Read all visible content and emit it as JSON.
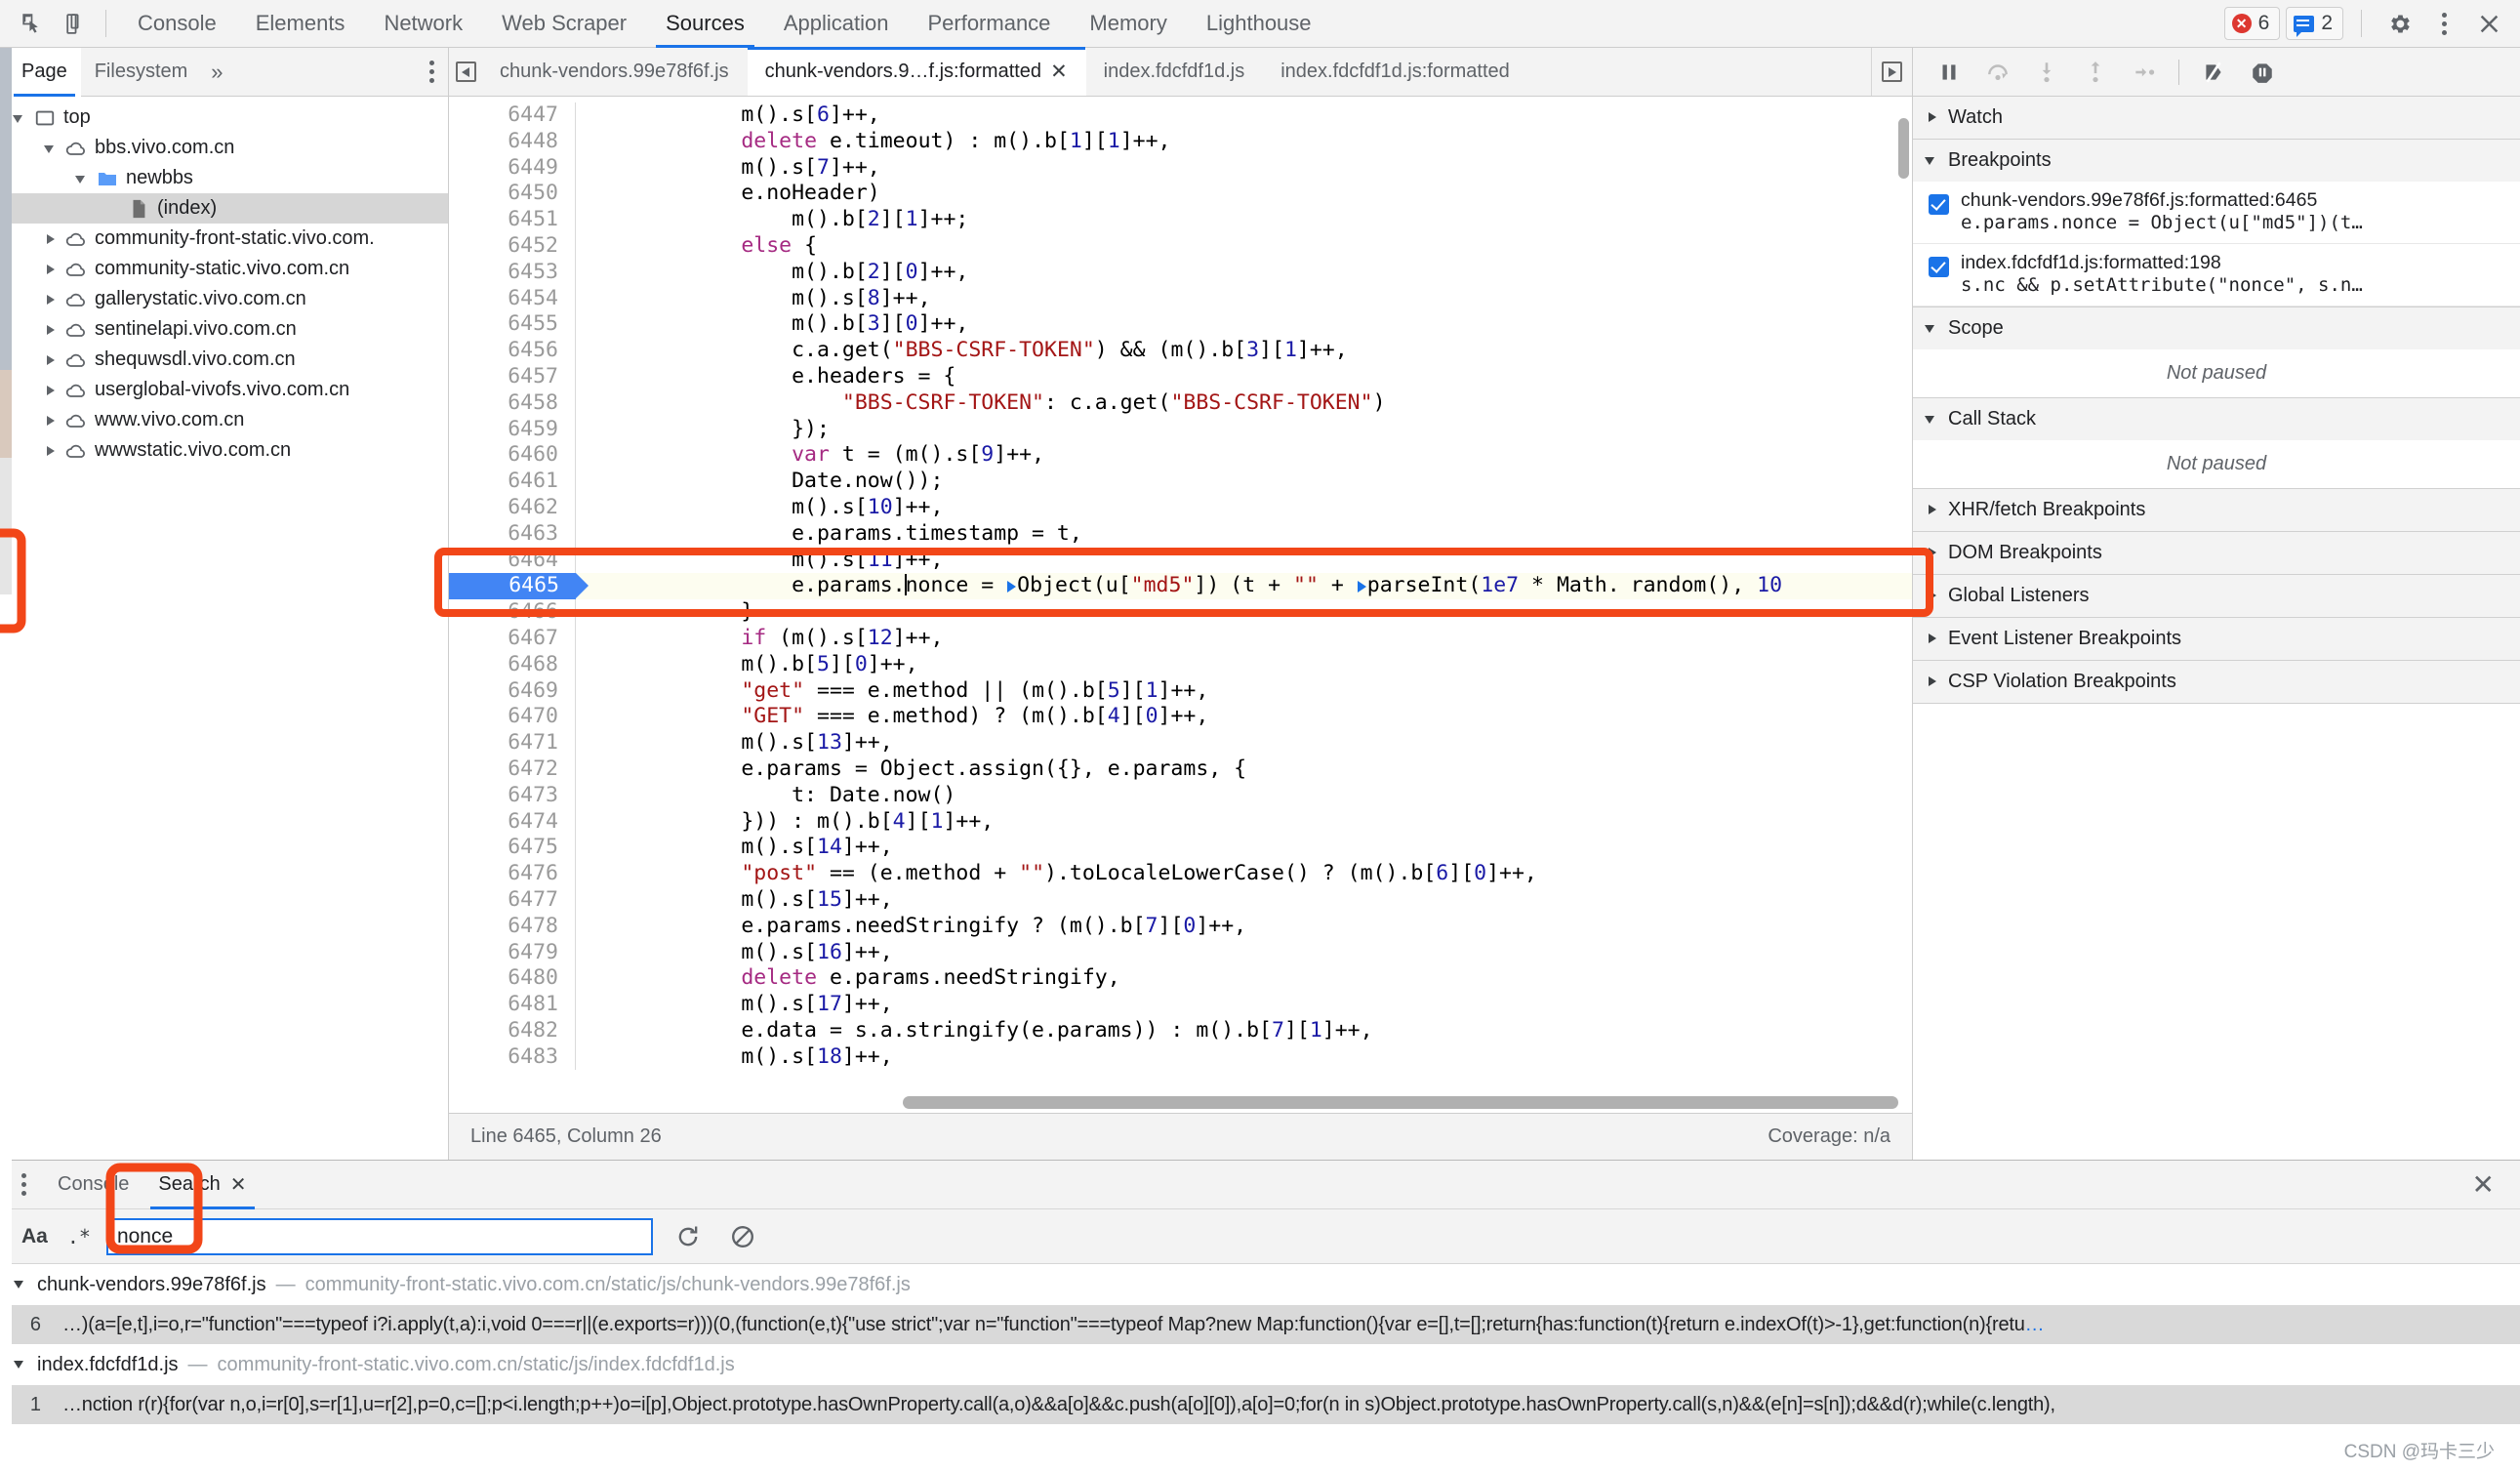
{
  "toolbar": {
    "icons": [
      "inspect-icon",
      "device-toggle-icon"
    ],
    "tabs": [
      {
        "label": "Console",
        "active": false
      },
      {
        "label": "Elements",
        "active": false
      },
      {
        "label": "Network",
        "active": false
      },
      {
        "label": "Web Scraper",
        "active": false
      },
      {
        "label": "Sources",
        "active": true
      },
      {
        "label": "Application",
        "active": false
      },
      {
        "label": "Performance",
        "active": false
      },
      {
        "label": "Memory",
        "active": false
      },
      {
        "label": "Lighthouse",
        "active": false
      }
    ],
    "error_count": "6",
    "message_count": "2",
    "settings_icon": "gear-icon",
    "more_icon": "kebab-menu-icon",
    "close_icon": "close-icon"
  },
  "navigator": {
    "tabs": [
      {
        "label": "Page",
        "active": true
      },
      {
        "label": "Filesystem",
        "active": false
      }
    ],
    "more_label": "»",
    "tree": [
      {
        "label": "top",
        "depth": 0,
        "icon": "frame-icon",
        "expanded": true,
        "selected": false
      },
      {
        "label": "bbs.vivo.com.cn",
        "depth": 1,
        "icon": "cloud-icon",
        "expanded": true,
        "selected": false
      },
      {
        "label": "newbbs",
        "depth": 2,
        "icon": "folder-icon",
        "expanded": true,
        "selected": false
      },
      {
        "label": "(index)",
        "depth": 3,
        "icon": "document-icon",
        "expanded": null,
        "selected": true
      },
      {
        "label": "community-front-static.vivo.com.",
        "depth": 1,
        "icon": "cloud-icon",
        "expanded": false,
        "selected": false
      },
      {
        "label": "community-static.vivo.com.cn",
        "depth": 1,
        "icon": "cloud-icon",
        "expanded": false,
        "selected": false
      },
      {
        "label": "gallerystatic.vivo.com.cn",
        "depth": 1,
        "icon": "cloud-icon",
        "expanded": false,
        "selected": false
      },
      {
        "label": "sentinelapi.vivo.com.cn",
        "depth": 1,
        "icon": "cloud-icon",
        "expanded": false,
        "selected": false
      },
      {
        "label": "shequwsdl.vivo.com.cn",
        "depth": 1,
        "icon": "cloud-icon",
        "expanded": false,
        "selected": false
      },
      {
        "label": "userglobal-vivofs.vivo.com.cn",
        "depth": 1,
        "icon": "cloud-icon",
        "expanded": false,
        "selected": false
      },
      {
        "label": "www.vivo.com.cn",
        "depth": 1,
        "icon": "cloud-icon",
        "expanded": false,
        "selected": false
      },
      {
        "label": "wwwstatic.vivo.com.cn",
        "depth": 1,
        "icon": "cloud-icon",
        "expanded": false,
        "selected": false
      }
    ]
  },
  "editor": {
    "file_tabs": [
      {
        "label": "chunk-vendors.99e78f6f.js",
        "active": false,
        "closable": false
      },
      {
        "label": "chunk-vendors.9…f.js:formatted",
        "active": true,
        "closable": true
      },
      {
        "label": "index.fdcfdf1d.js",
        "active": false,
        "closable": false
      },
      {
        "label": "index.fdcfdf1d.js:formatted",
        "active": false,
        "closable": false
      }
    ],
    "status_left": "Line 6465, Column 26",
    "status_right": "Coverage: n/a",
    "lines": [
      {
        "n": "6447",
        "code": "            m().s[6]++,"
      },
      {
        "n": "6448",
        "code": "            delete e.timeout) : m().b[1][1]++,"
      },
      {
        "n": "6449",
        "code": "            m().s[7]++,"
      },
      {
        "n": "6450",
        "code": "            e.noHeader)"
      },
      {
        "n": "6451",
        "code": "                m().b[2][1]++;"
      },
      {
        "n": "6452",
        "code": "            else {"
      },
      {
        "n": "6453",
        "code": "                m().b[2][0]++,"
      },
      {
        "n": "6454",
        "code": "                m().s[8]++,"
      },
      {
        "n": "6455",
        "code": "                m().b[3][0]++,"
      },
      {
        "n": "6456",
        "code": "                c.a.get(\"BBS-CSRF-TOKEN\") && (m().b[3][1]++,"
      },
      {
        "n": "6457",
        "code": "                e.headers = {"
      },
      {
        "n": "6458",
        "code": "                    \"BBS-CSRF-TOKEN\": c.a.get(\"BBS-CSRF-TOKEN\")"
      },
      {
        "n": "6459",
        "code": "                });"
      },
      {
        "n": "6460",
        "code": "                var t = (m().s[9]++,"
      },
      {
        "n": "6461",
        "code": "                Date.now());"
      },
      {
        "n": "6462",
        "code": "                m().s[10]++,"
      },
      {
        "n": "6463",
        "code": "                e.params.timestamp = t,"
      },
      {
        "n": "6464",
        "code": "                m().s[11]++,"
      },
      {
        "n": "6465",
        "code": "                e.params.nonce = Object(u[\"md5\"])(t + \"\" + parseInt(1e7 * Math.random(), 10"
      },
      {
        "n": "6466",
        "code": "            }"
      },
      {
        "n": "6467",
        "code": "            if (m().s[12]++,"
      },
      {
        "n": "6468",
        "code": "            m().b[5][0]++,"
      },
      {
        "n": "6469",
        "code": "            \"get\" === e.method || (m().b[5][1]++,"
      },
      {
        "n": "6470",
        "code": "            \"GET\" === e.method) ? (m().b[4][0]++,"
      },
      {
        "n": "6471",
        "code": "            m().s[13]++,"
      },
      {
        "n": "6472",
        "code": "            e.params = Object.assign({}, e.params, {"
      },
      {
        "n": "6473",
        "code": "                t: Date.now()"
      },
      {
        "n": "6474",
        "code": "            })) : m().b[4][1]++,"
      },
      {
        "n": "6475",
        "code": "            m().s[14]++,"
      },
      {
        "n": "6476",
        "code": "            \"post\" == (e.method + \"\").toLocaleLowerCase() ? (m().b[6][0]++,"
      },
      {
        "n": "6477",
        "code": "            m().s[15]++,"
      },
      {
        "n": "6478",
        "code": "            e.params.needStringify ? (m().b[7][0]++,"
      },
      {
        "n": "6479",
        "code": "            m().s[16]++,"
      },
      {
        "n": "6480",
        "code": "            delete e.params.needStringify,"
      },
      {
        "n": "6481",
        "code": "            m().s[17]++,"
      },
      {
        "n": "6482",
        "code": "            e.data = s.a.stringify(e.params)) : m().b[7][1]++,"
      },
      {
        "n": "6483",
        "code": "            m().s[18]++,"
      }
    ],
    "breakpoint_line": "6465"
  },
  "debugger": {
    "controls": [
      "resume-icon",
      "step-over-icon",
      "step-into-icon",
      "step-out-icon",
      "step-icon",
      "deactivate-breakpoints-icon",
      "pause-on-exceptions-icon"
    ],
    "sections": [
      {
        "title": "Watch",
        "expanded": false
      },
      {
        "title": "Breakpoints",
        "expanded": true
      },
      {
        "title": "Scope",
        "expanded": true
      },
      {
        "title": "Call Stack",
        "expanded": true
      },
      {
        "title": "XHR/fetch Breakpoints",
        "expanded": false
      },
      {
        "title": "DOM Breakpoints",
        "expanded": false
      },
      {
        "title": "Global Listeners",
        "expanded": false
      },
      {
        "title": "Event Listener Breakpoints",
        "expanded": false
      },
      {
        "title": "CSP Violation Breakpoints",
        "expanded": false
      }
    ],
    "breakpoints": [
      {
        "checked": true,
        "location": "chunk-vendors.99e78f6f.js:formatted:6465",
        "snippet": "e.params.nonce = Object(u[\"md5\"])(t…"
      },
      {
        "checked": true,
        "location": "index.fdcfdf1d.js:formatted:198",
        "snippet": "s.nc && p.setAttribute(\"nonce\", s.n…"
      }
    ],
    "scope_status": "Not paused",
    "callstack_status": "Not paused"
  },
  "drawer": {
    "menu_icon": "kebab-menu-icon",
    "tabs": [
      {
        "label": "Console",
        "active": false,
        "closable": false
      },
      {
        "label": "Search",
        "active": true,
        "closable": true
      }
    ],
    "close_icon": "close-icon",
    "search": {
      "match_case_label": "Aa",
      "regex_label": ".*",
      "value": "nonce",
      "refresh_icon": "refresh-icon",
      "clear_icon": "clear-icon"
    },
    "results": [
      {
        "file": "chunk-vendors.99e78f6f.js",
        "dash": "—",
        "url": "community-front-static.vivo.com.cn/static/js/chunk-vendors.99e78f6f.js",
        "expanded": true,
        "matches": [
          {
            "line": "6",
            "text": "…)(a=[e,t],i=o,r=\"function\"===typeof i?i.apply(t,a):i,void 0===r||(e.exports=r)))(0,(function(e,t){\"use strict\";var n=\"function\"===typeof Map?new Map:function(){var e=[],t=[];return{has:function(t){return e.indexOf(t)>-1},get:function(n){retu",
            "ellipsis": "…"
          }
        ]
      },
      {
        "file": "index.fdcfdf1d.js",
        "dash": "—",
        "url": "community-front-static.vivo.com.cn/static/js/index.fdcfdf1d.js",
        "expanded": true,
        "matches": [
          {
            "line": "1",
            "text": "…nction r(r){for(var n,o,i=r[0],s=r[1],u=r[2],p=0,c=[];p<i.length;p++)o=i[p],Object.prototype.hasOwnProperty.call(a,o)&&a[o]&&c.push(a[o][0]),a[o]=0;for(n in s)Object.prototype.hasOwnProperty.call(s,n)&&(e[n]=s[n]);d&&d(r);while(c.length),",
            "ellipsis": ""
          }
        ]
      }
    ]
  },
  "watermark": "CSDN @玛卡三少",
  "colors": {
    "accent": "#1a73e8",
    "error": "#dd3730",
    "annotation": "#f24618",
    "toolbar_bg": "#f3f3f3",
    "selection_bg": "#d6d6d6"
  }
}
